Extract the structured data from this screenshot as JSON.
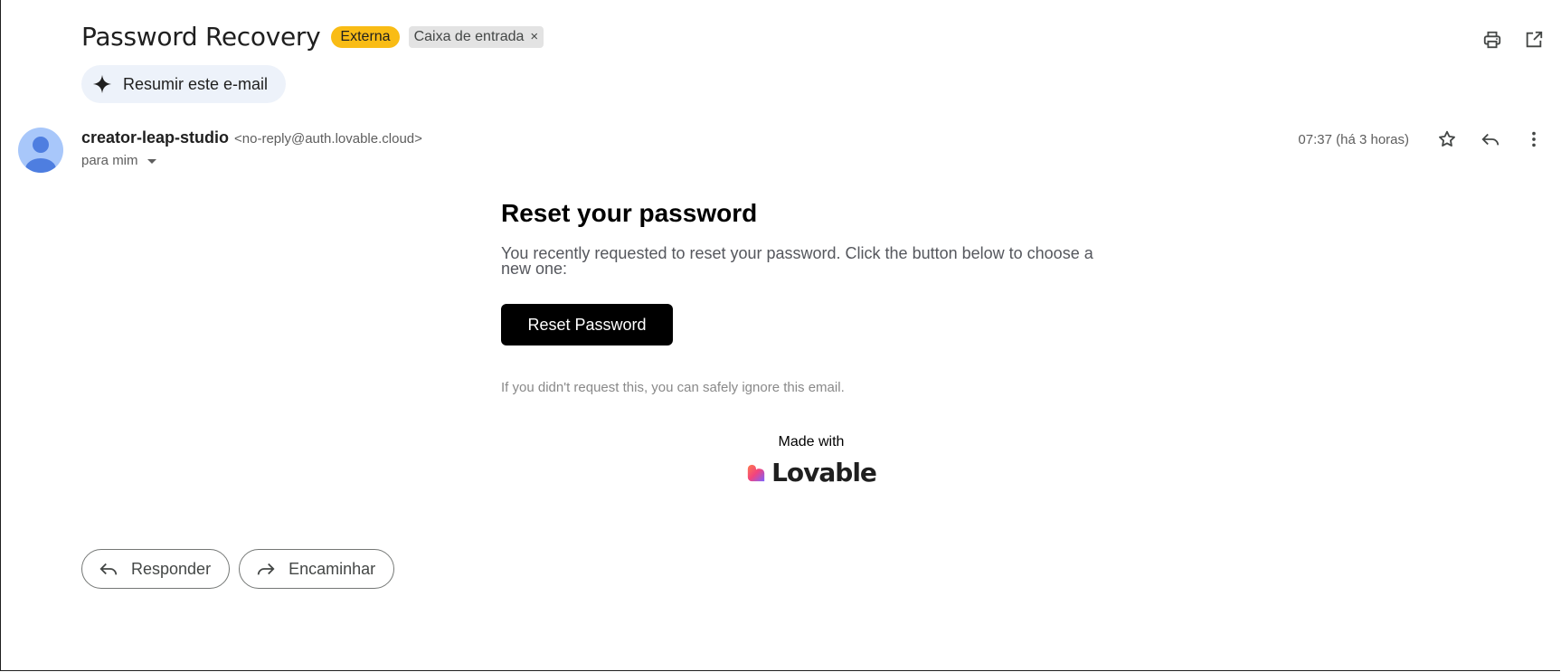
{
  "header": {
    "subject": "Password Recovery",
    "labels": {
      "external": "Externa",
      "inbox": "Caixa de entrada",
      "inbox_remove": "×"
    }
  },
  "summary": {
    "label": "Resumir este e-mail"
  },
  "sender": {
    "name": "creator-leap-studio",
    "email": "<no-reply@auth.lovable.cloud>",
    "to": "para mim",
    "timestamp": "07:37 (há 3 horas)"
  },
  "email": {
    "title": "Reset your password",
    "body": "You recently requested to reset your password. Click the button below to choose a new one:",
    "button": "Reset Password",
    "ignore": "If you didn't request this, you can safely ignore this email.",
    "made_with": "Made with",
    "brand": "Lovable"
  },
  "actions": {
    "reply": "Responder",
    "forward": "Encaminhar"
  },
  "colors": {
    "external_badge": "#f9bc15",
    "summary_bg": "#edf2fa",
    "avatar_bg": "#a8c7fa",
    "avatar_fg": "#4e7ee0"
  },
  "icons": [
    "print-icon",
    "open-in-new-window-icon",
    "sparkle-icon",
    "star-icon",
    "reply-icon",
    "more-vert-icon",
    "forward-icon",
    "lovable-heart-icon"
  ]
}
